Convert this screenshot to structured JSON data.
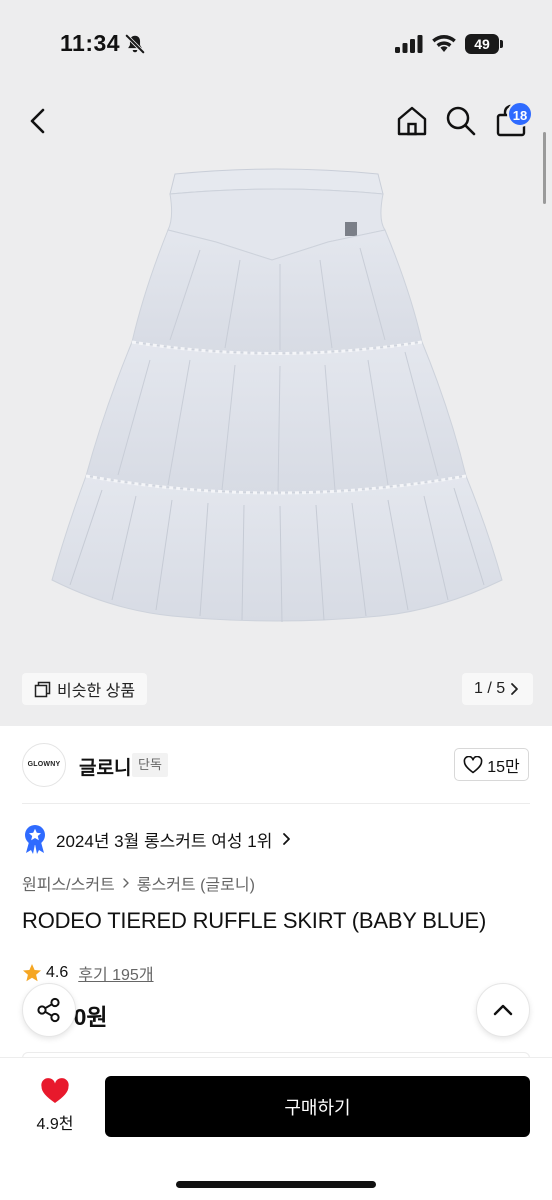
{
  "status_bar": {
    "time": "11:34",
    "battery_level": "49",
    "icons": [
      "bell-slash-icon",
      "cellular-signal-icon",
      "wifi-icon",
      "battery-icon"
    ]
  },
  "header": {
    "icons": [
      "chevron-left-icon",
      "home-icon",
      "search-icon",
      "shopping-bag-icon"
    ],
    "cart_count": "18"
  },
  "gallery": {
    "similar_label": "비슷한 상품",
    "page_indicator": "1 / 5",
    "image_subject": "skirt-photo"
  },
  "brand": {
    "logo_text": "GLOWNY",
    "name": "글로니",
    "badge": "단독",
    "likes": "15만"
  },
  "ranking": {
    "text": "2024년 3월 롱스커트 여성 1위"
  },
  "breadcrumb": {
    "category": "원피스/스커트",
    "subcategory": "롱스커트 (글로니)"
  },
  "product": {
    "title": "RODEO TIERED RUFFLE SKIRT (BABY BLUE)",
    "rating": "4.6",
    "reviews_label": "후기 195개",
    "price_visible": "000원"
  },
  "bottom_bar": {
    "wish_count": "4.9천",
    "buy_label": "구매하기"
  },
  "colors": {
    "accent_blue": "#2f6bff",
    "heart_red": "#e8192c",
    "star_orange": "#f5a623",
    "buy_button_bg": "#000000",
    "image_bg": "#ededee"
  }
}
